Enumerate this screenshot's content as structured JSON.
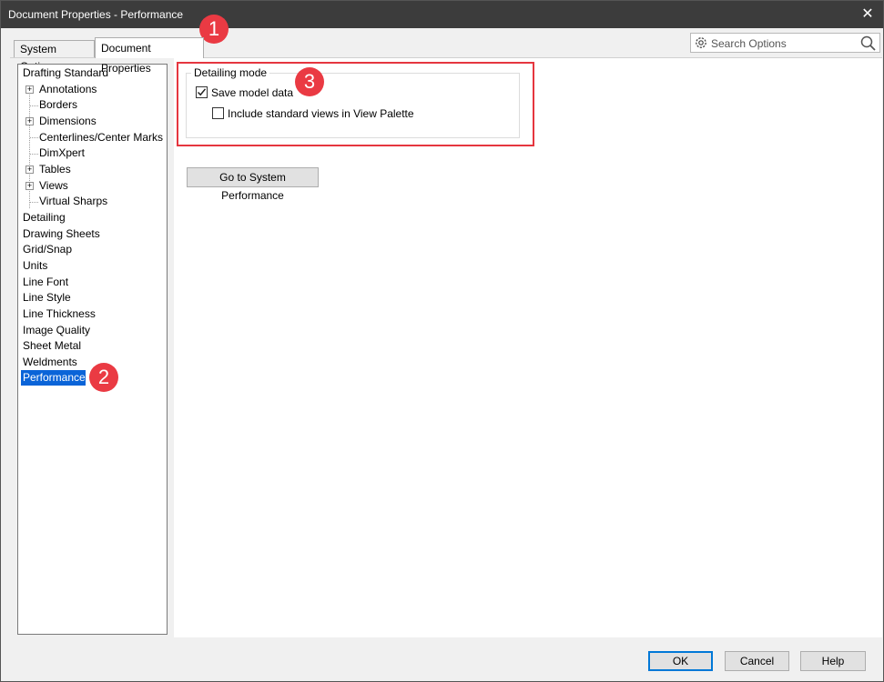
{
  "window": {
    "title": "Document Properties - Performance",
    "close_glyph": "✕"
  },
  "tabs": {
    "system": "System Options",
    "document": "Document Properties"
  },
  "search": {
    "placeholder": "Search Options"
  },
  "tree": {
    "items": [
      "Drafting Standard",
      "Annotations",
      "Borders",
      "Dimensions",
      "Centerlines/Center Marks",
      "DimXpert",
      "Tables",
      "Views",
      "Virtual Sharps",
      "Detailing",
      "Drawing Sheets",
      "Grid/Snap",
      "Units",
      "Line Font",
      "Line Style",
      "Line Thickness",
      "Image Quality",
      "Sheet Metal",
      "Weldments",
      "Performance"
    ],
    "expanders": [
      "+",
      "+",
      "+",
      "+"
    ],
    "selected": "Performance"
  },
  "group": {
    "label": "Detailing mode",
    "save_model_data": {
      "label": "Save model data",
      "checked": true
    },
    "include_standard_views": {
      "label": "Include standard views in View Palette",
      "checked": false
    }
  },
  "buttons": {
    "goto_performance": "Go to System Performance",
    "ok": "OK",
    "cancel": "Cancel",
    "help": "Help"
  },
  "callouts": [
    "1",
    "2",
    "3"
  ],
  "colors": {
    "callout": "#ea3a43",
    "highlight_border": "#e5363f",
    "selection": "#0a64d8",
    "titlebar": "#3c3c3c"
  },
  "icons": {
    "search": "search-icon",
    "settings": "gear-icon",
    "close": "close-icon",
    "checkmark": "checkmark-icon"
  }
}
